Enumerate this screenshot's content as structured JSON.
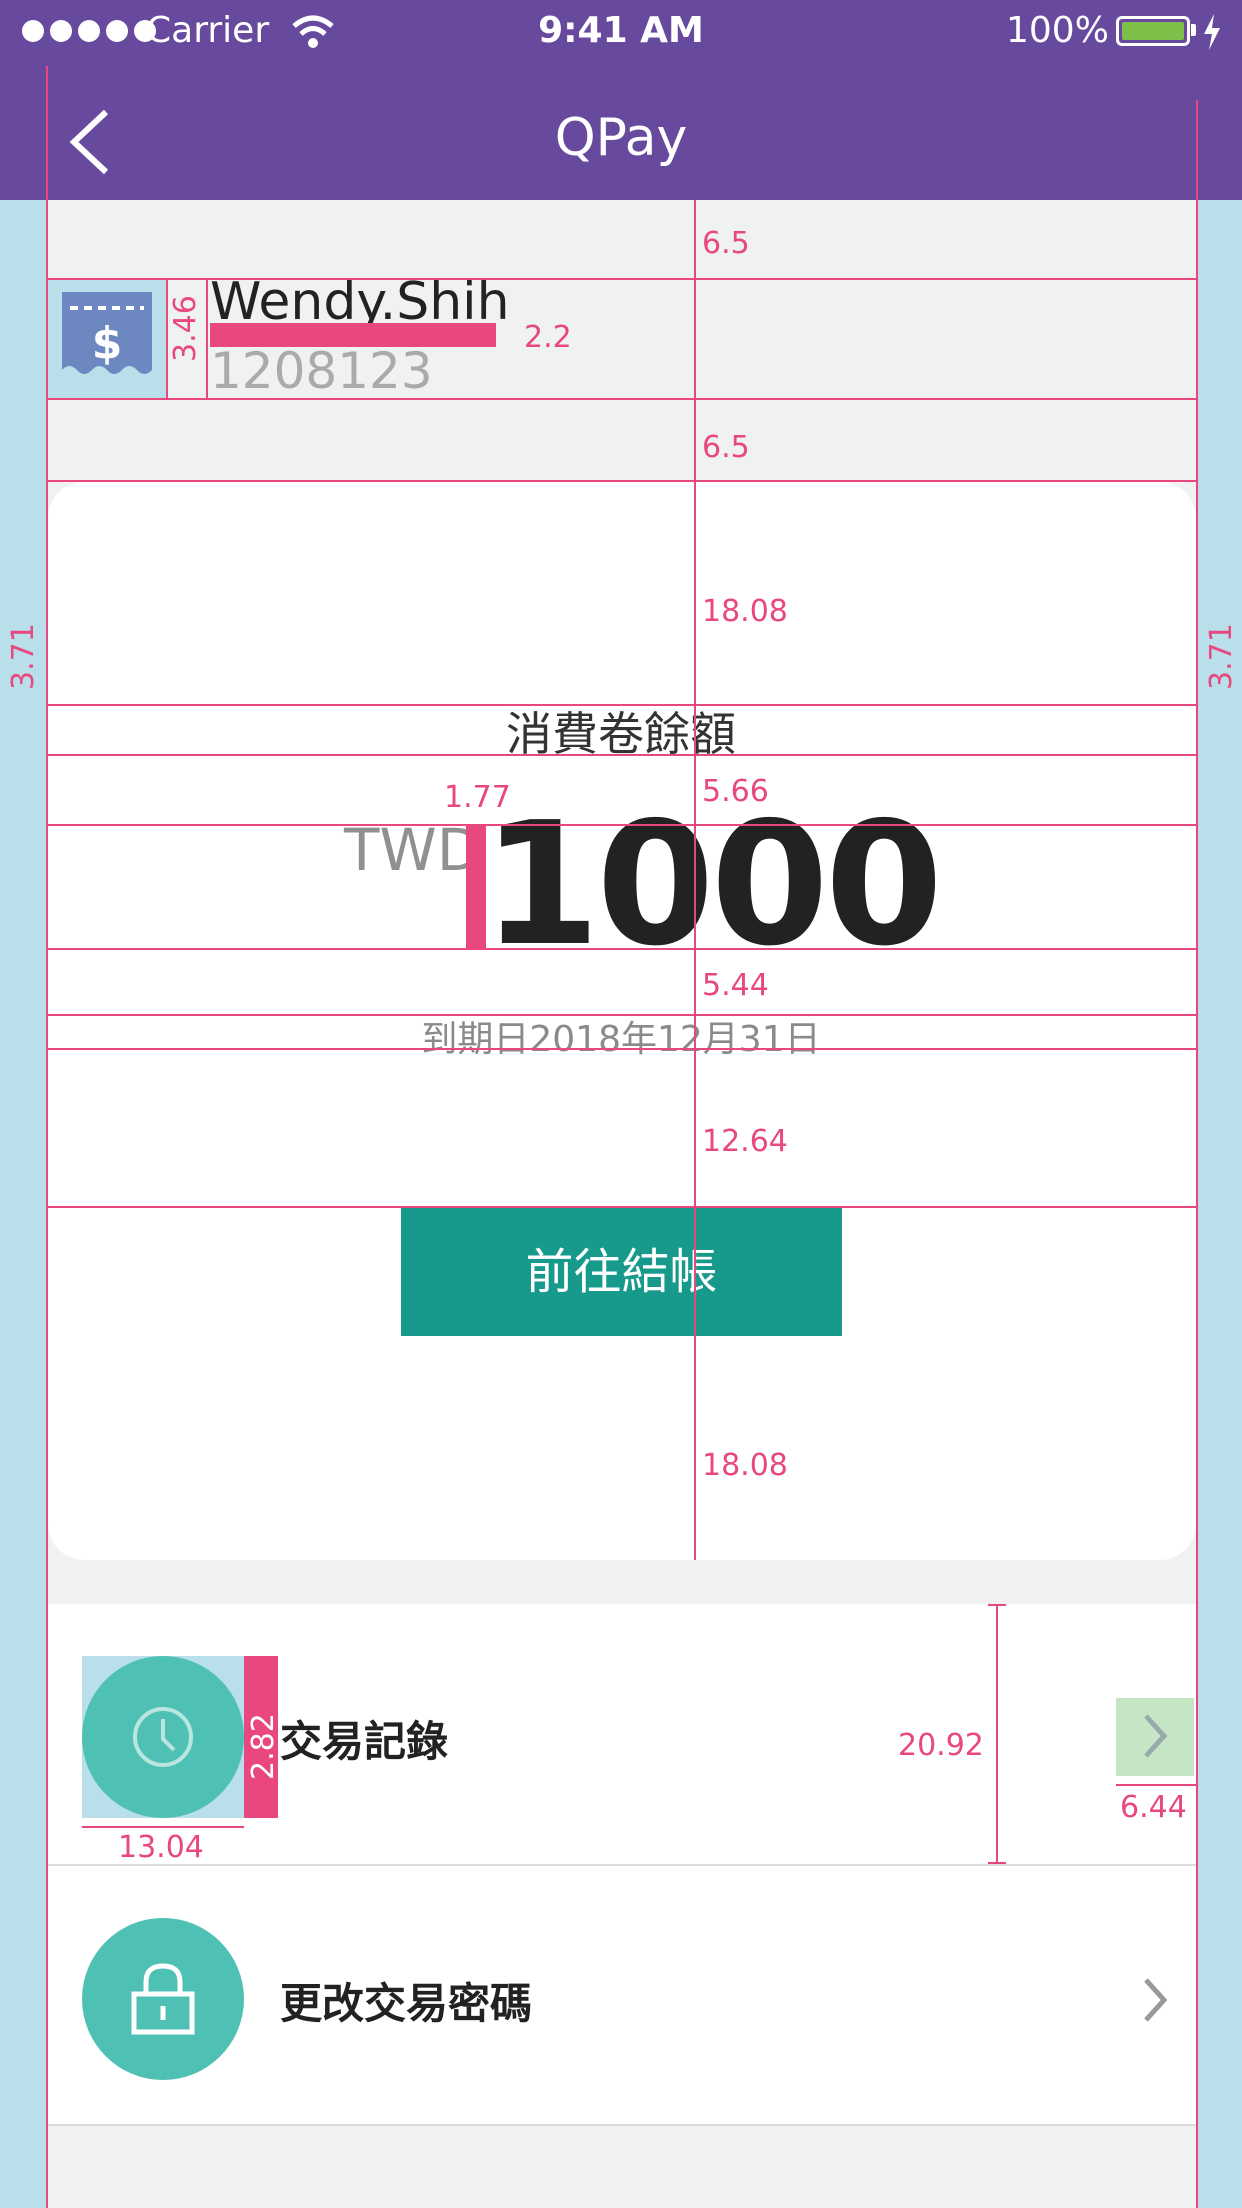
{
  "status_bar": {
    "carrier": "Carrier",
    "time": "9:41 AM",
    "battery": "100%",
    "battery_level": 1.0
  },
  "nav": {
    "title": "QPay"
  },
  "user": {
    "name": "Wendy.Shih",
    "id": "1208123"
  },
  "balance": {
    "title": "消費卷餘額",
    "currency": "TWD",
    "amount": "1000",
    "expiry": "到期日2018年12月31日",
    "checkout_label": "前往結帳"
  },
  "menu": [
    {
      "label": "交易記錄",
      "icon": "clock-icon"
    },
    {
      "label": "更改交易密碼",
      "icon": "lock-icon"
    }
  ],
  "spec_annotations": {
    "top_gap": "6.5",
    "name_icon_height": "3.46",
    "name_id_gap": "2.2",
    "card_gap": "6.5",
    "side_margin_left": "3.71",
    "side_margin_right": "3.71",
    "card_top_pad": "18.08",
    "title_amount_gap": "5.66",
    "currency_amount_gap": "1.77",
    "amount_expiry_gap": "5.44",
    "expiry_button_gap": "12.64",
    "card_bottom_pad": "18.08",
    "menu_row_height": "20.92",
    "icon_label_gap": "2.82",
    "icon_width": "13.04",
    "chevron_width": "6.44"
  },
  "colors": {
    "nav_bg": "#674a9e",
    "checkout_bg": "#179a8b",
    "menu_icon_bg": "#4fc1b4",
    "annotation": "#e8487f",
    "guide_fill": "#b9e0ea"
  }
}
